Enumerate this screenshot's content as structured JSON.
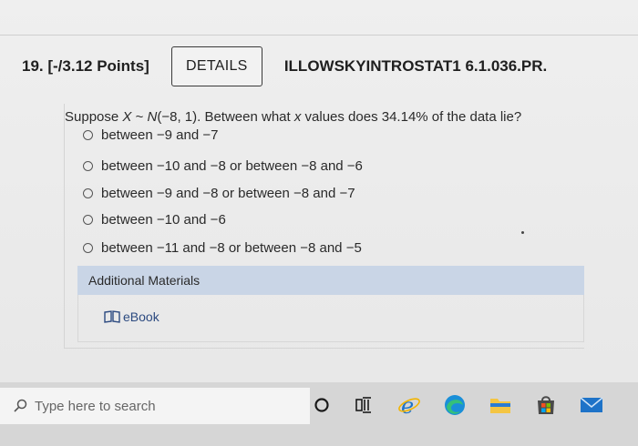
{
  "question": {
    "number_points": "19. [-/3.12 Points]",
    "details_label": "DETAILS",
    "assignment_id": "ILLOWSKYINTROSTAT1 6.1.036.PR.",
    "prompt_pre": "Suppose ",
    "prompt_var": "X",
    "prompt_tilde": " ~ ",
    "prompt_dist": "N",
    "prompt_params": "(−8, 1). Between what ",
    "prompt_x": "x",
    "prompt_post": " values does 34.14% of the data lie?",
    "options": [
      "between −9 and −7",
      "between −10 and −8 or between −8 and −6",
      "between −9 and −8 or between −8 and −7",
      "between −10 and −6",
      "between −11 and −8 or between −8 and −5"
    ]
  },
  "additional_materials": {
    "heading": "Additional Materials",
    "ebook_label": "eBook"
  },
  "taskbar": {
    "search_placeholder": "Type here to search"
  },
  "colors": {
    "materials_header": "#c9d5e6",
    "link": "#2c4a80"
  }
}
